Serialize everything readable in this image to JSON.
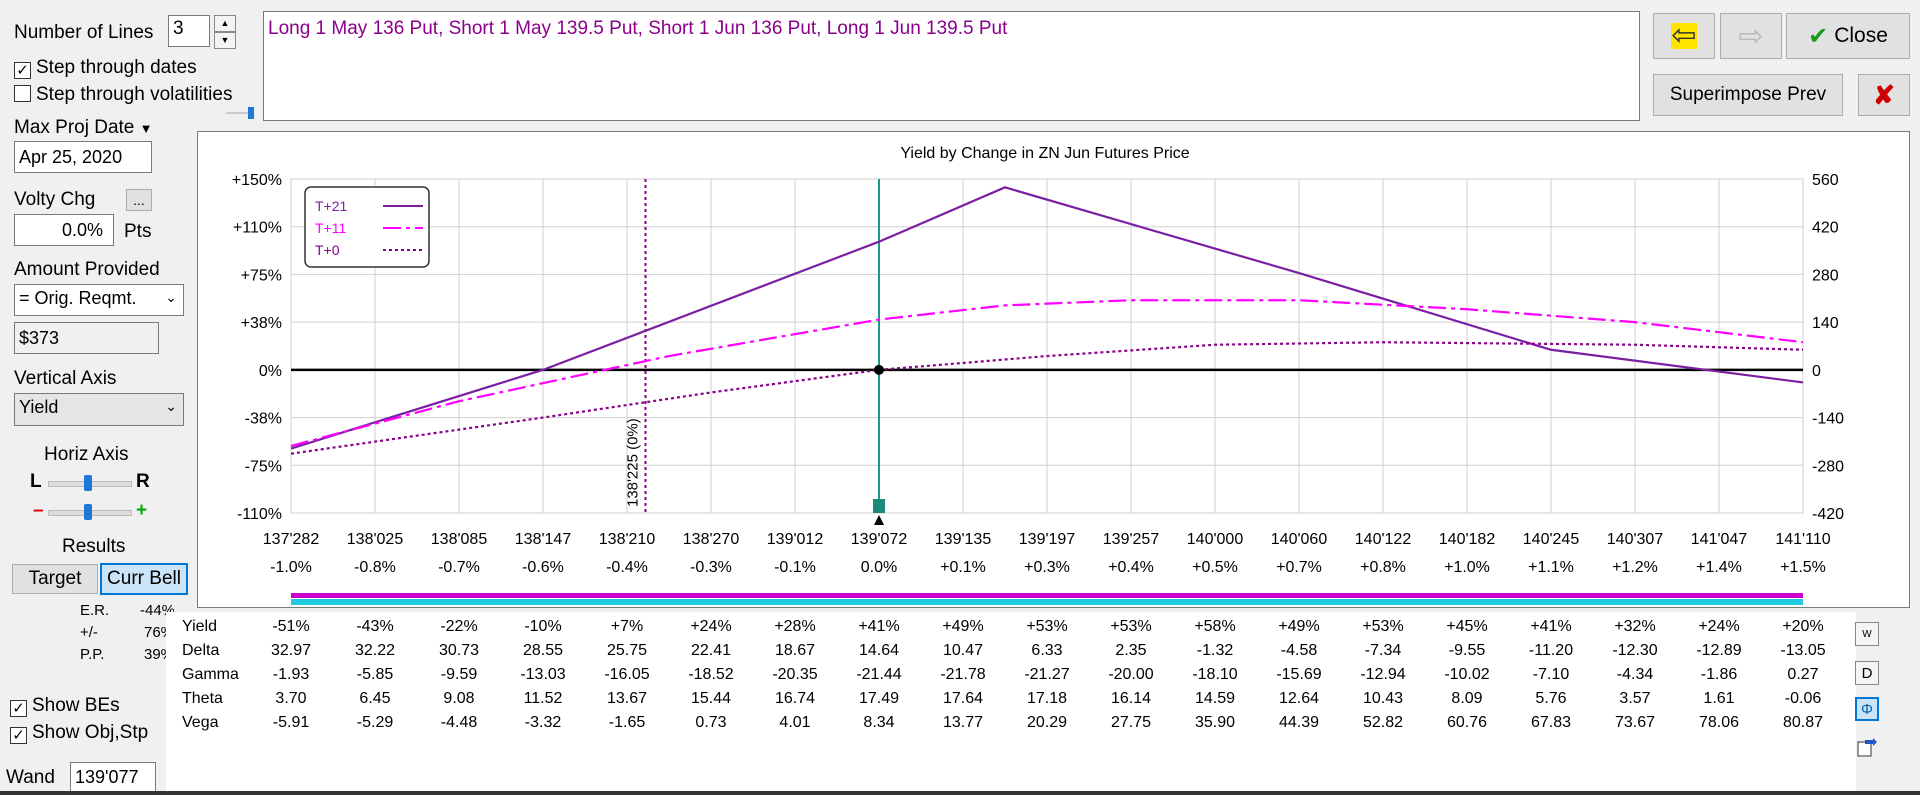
{
  "left": {
    "num_lines_label": "Number of Lines",
    "num_lines_value": "3",
    "step_dates_label": "Step through dates",
    "step_dates_checked": "✓",
    "step_vol_label": "Step through volatilities",
    "max_proj_label": "Max Proj Date",
    "max_proj_value": "Apr 25, 2020",
    "volty_label": "Volty Chg",
    "volty_btn": "...",
    "volty_value": "0.0%",
    "volty_unit": "Pts",
    "amount_label": "Amount Provided",
    "amount_combo": "= Orig. Reqmt.",
    "amount_value": "$373",
    "vert_axis_label": "Vertical Axis",
    "vert_axis_value": "Yield",
    "horiz_axis_label": "Horiz Axis",
    "slider_l": "L",
    "slider_r": "R",
    "slider_minus": "–",
    "slider_plus": "+",
    "results_label": "Results",
    "target_btn": "Target",
    "curr_bell_btn": "Curr Bell",
    "er_label": "E.R.",
    "er_value": "-44%",
    "pm_label": "+/-",
    "pm_value": "76%",
    "pp_label": "P.P.",
    "pp_value": "39%",
    "show_bes_label": "Show BEs",
    "show_obj_label": "Show Obj,Stp",
    "wand_label": "Wand",
    "wand_value": "139'077",
    "check_mark": "✓"
  },
  "legs_text": "Long 1 May 136 Put, Short 1 May 139.5 Put, Short 1 Jun 136 Put, Long 1 Jun 139.5 Put",
  "toolbar": {
    "close_label": "Close",
    "close_check": "✔",
    "superimpose_label": "Superimpose Prev",
    "x_label": "✘",
    "back_icon": "⇦",
    "fwd_icon": "⇨"
  },
  "chart_data": {
    "type": "line",
    "title": "Yield by Change in ZN Jun Futures Price",
    "x_ticks": [
      "137'282",
      "138'025",
      "138'085",
      "138'147",
      "138'210",
      "138'270",
      "139'012",
      "139'072",
      "139'135",
      "139'197",
      "139'257",
      "140'000",
      "140'060",
      "140'122",
      "140'182",
      "140'245",
      "140'307",
      "141'047",
      "141'110"
    ],
    "x_pct_ticks": [
      "-1.0%",
      "-0.8%",
      "-0.7%",
      "-0.6%",
      "-0.4%",
      "-0.3%",
      "-0.1%",
      "0.0%",
      "+0.1%",
      "+0.3%",
      "+0.4%",
      "+0.5%",
      "+0.7%",
      "+0.8%",
      "+1.0%",
      "+1.1%",
      "+1.2%",
      "+1.4%",
      "+1.5%"
    ],
    "y_left_ticks": [
      "+150%",
      "+110%",
      "+75%",
      "+38%",
      "0%",
      "-38%",
      "-75%",
      "-110%"
    ],
    "y_left_values": [
      150,
      110,
      75,
      38,
      0,
      -38,
      -75,
      -110
    ],
    "y_right_ticks": [
      "560",
      "420",
      "280",
      "140",
      "0",
      "-140",
      "-280",
      "-420"
    ],
    "ylim": [
      -110,
      150
    ],
    "x_index_range": [
      0,
      18
    ],
    "marker_label": "138'225 (0%)",
    "marker_x_index": 4.22,
    "current_x_index": 7,
    "grid": true,
    "legend_position": "top-left",
    "series": [
      {
        "name": "T+21",
        "color": "#7b1fa2",
        "style": "solid",
        "x": [
          0,
          3,
          7,
          8.5,
          12,
          15,
          18
        ],
        "values": [
          -62,
          0,
          99,
          143,
          76,
          16,
          -10
        ]
      },
      {
        "name": "T+11",
        "color": "#ff00ff",
        "style": "dashed",
        "x": [
          0,
          2,
          4.5,
          7,
          8.5,
          10,
          12,
          14,
          16,
          18
        ],
        "values": [
          -60,
          -25,
          11,
          40,
          51,
          55,
          55,
          48,
          38,
          22
        ]
      },
      {
        "name": "T+0",
        "color": "#8b008b",
        "style": "dotted",
        "x": [
          0,
          3,
          5,
          7,
          9,
          11,
          13,
          16,
          18
        ],
        "values": [
          -66,
          -38,
          -18,
          0,
          11,
          20,
          22,
          20,
          16
        ]
      }
    ]
  },
  "table": {
    "rows": [
      {
        "label": "Yield",
        "values": [
          "-51%",
          "-43%",
          "-22%",
          "-10%",
          "+7%",
          "+24%",
          "+28%",
          "+41%",
          "+49%",
          "+53%",
          "+53%",
          "+58%",
          "+49%",
          "+53%",
          "+45%",
          "+41%",
          "+32%",
          "+24%",
          "+20%"
        ]
      },
      {
        "label": "Delta",
        "values": [
          "32.97",
          "32.22",
          "30.73",
          "28.55",
          "25.75",
          "22.41",
          "18.67",
          "14.64",
          "10.47",
          "6.33",
          "2.35",
          "-1.32",
          "-4.58",
          "-7.34",
          "-9.55",
          "-11.20",
          "-12.30",
          "-12.89",
          "-13.05"
        ]
      },
      {
        "label": "Gamma",
        "values": [
          "-1.93",
          "-5.85",
          "-9.59",
          "-13.03",
          "-16.05",
          "-18.52",
          "-20.35",
          "-21.44",
          "-21.78",
          "-21.27",
          "-20.00",
          "-18.10",
          "-15.69",
          "-12.94",
          "-10.02",
          "-7.10",
          "-4.34",
          "-1.86",
          "0.27"
        ]
      },
      {
        "label": "Theta",
        "values": [
          "3.70",
          "6.45",
          "9.08",
          "11.52",
          "13.67",
          "15.44",
          "16.74",
          "17.49",
          "17.64",
          "17.18",
          "16.14",
          "14.59",
          "12.64",
          "10.43",
          "8.09",
          "5.76",
          "3.57",
          "1.61",
          "-0.06"
        ]
      },
      {
        "label": "Vega",
        "values": [
          "-5.91",
          "-5.29",
          "-4.48",
          "-3.32",
          "-1.65",
          "0.73",
          "4.01",
          "8.34",
          "13.77",
          "20.29",
          "27.75",
          "35.90",
          "44.39",
          "52.82",
          "60.76",
          "67.83",
          "73.67",
          "78.06",
          "80.87"
        ]
      }
    ]
  },
  "side_icons": {
    "w_label": "W",
    "d_label": "D",
    "phi_label": "Φ"
  }
}
